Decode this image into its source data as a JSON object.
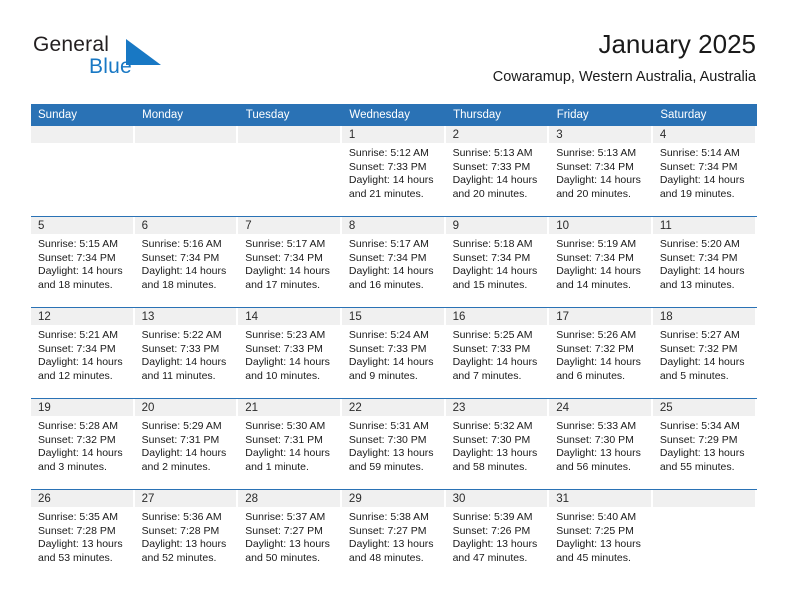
{
  "brand": {
    "name_part1": "General",
    "name_part2": "Blue",
    "logo_icon": "triangle-flag-icon"
  },
  "header": {
    "title": "January 2025",
    "subtitle": "Cowaramup, Western Australia, Australia"
  },
  "colors": {
    "accent_blue": "#2a72b5",
    "brand_blue": "#1878c4",
    "day_band_gray": "#f0f0f0"
  },
  "weekday_headers": [
    "Sunday",
    "Monday",
    "Tuesday",
    "Wednesday",
    "Thursday",
    "Friday",
    "Saturday"
  ],
  "weeks": [
    [
      {
        "day": "",
        "empty": true
      },
      {
        "day": "",
        "empty": true
      },
      {
        "day": "",
        "empty": true
      },
      {
        "day": "1",
        "sunrise": "Sunrise: 5:12 AM",
        "sunset": "Sunset: 7:33 PM",
        "daylight_line1": "Daylight: 14 hours",
        "daylight_line2": "and 21 minutes."
      },
      {
        "day": "2",
        "sunrise": "Sunrise: 5:13 AM",
        "sunset": "Sunset: 7:33 PM",
        "daylight_line1": "Daylight: 14 hours",
        "daylight_line2": "and 20 minutes."
      },
      {
        "day": "3",
        "sunrise": "Sunrise: 5:13 AM",
        "sunset": "Sunset: 7:34 PM",
        "daylight_line1": "Daylight: 14 hours",
        "daylight_line2": "and 20 minutes."
      },
      {
        "day": "4",
        "sunrise": "Sunrise: 5:14 AM",
        "sunset": "Sunset: 7:34 PM",
        "daylight_line1": "Daylight: 14 hours",
        "daylight_line2": "and 19 minutes."
      }
    ],
    [
      {
        "day": "5",
        "sunrise": "Sunrise: 5:15 AM",
        "sunset": "Sunset: 7:34 PM",
        "daylight_line1": "Daylight: 14 hours",
        "daylight_line2": "and 18 minutes."
      },
      {
        "day": "6",
        "sunrise": "Sunrise: 5:16 AM",
        "sunset": "Sunset: 7:34 PM",
        "daylight_line1": "Daylight: 14 hours",
        "daylight_line2": "and 18 minutes."
      },
      {
        "day": "7",
        "sunrise": "Sunrise: 5:17 AM",
        "sunset": "Sunset: 7:34 PM",
        "daylight_line1": "Daylight: 14 hours",
        "daylight_line2": "and 17 minutes."
      },
      {
        "day": "8",
        "sunrise": "Sunrise: 5:17 AM",
        "sunset": "Sunset: 7:34 PM",
        "daylight_line1": "Daylight: 14 hours",
        "daylight_line2": "and 16 minutes."
      },
      {
        "day": "9",
        "sunrise": "Sunrise: 5:18 AM",
        "sunset": "Sunset: 7:34 PM",
        "daylight_line1": "Daylight: 14 hours",
        "daylight_line2": "and 15 minutes."
      },
      {
        "day": "10",
        "sunrise": "Sunrise: 5:19 AM",
        "sunset": "Sunset: 7:34 PM",
        "daylight_line1": "Daylight: 14 hours",
        "daylight_line2": "and 14 minutes."
      },
      {
        "day": "11",
        "sunrise": "Sunrise: 5:20 AM",
        "sunset": "Sunset: 7:34 PM",
        "daylight_line1": "Daylight: 14 hours",
        "daylight_line2": "and 13 minutes."
      }
    ],
    [
      {
        "day": "12",
        "sunrise": "Sunrise: 5:21 AM",
        "sunset": "Sunset: 7:34 PM",
        "daylight_line1": "Daylight: 14 hours",
        "daylight_line2": "and 12 minutes."
      },
      {
        "day": "13",
        "sunrise": "Sunrise: 5:22 AM",
        "sunset": "Sunset: 7:33 PM",
        "daylight_line1": "Daylight: 14 hours",
        "daylight_line2": "and 11 minutes."
      },
      {
        "day": "14",
        "sunrise": "Sunrise: 5:23 AM",
        "sunset": "Sunset: 7:33 PM",
        "daylight_line1": "Daylight: 14 hours",
        "daylight_line2": "and 10 minutes."
      },
      {
        "day": "15",
        "sunrise": "Sunrise: 5:24 AM",
        "sunset": "Sunset: 7:33 PM",
        "daylight_line1": "Daylight: 14 hours",
        "daylight_line2": "and 9 minutes."
      },
      {
        "day": "16",
        "sunrise": "Sunrise: 5:25 AM",
        "sunset": "Sunset: 7:33 PM",
        "daylight_line1": "Daylight: 14 hours",
        "daylight_line2": "and 7 minutes."
      },
      {
        "day": "17",
        "sunrise": "Sunrise: 5:26 AM",
        "sunset": "Sunset: 7:32 PM",
        "daylight_line1": "Daylight: 14 hours",
        "daylight_line2": "and 6 minutes."
      },
      {
        "day": "18",
        "sunrise": "Sunrise: 5:27 AM",
        "sunset": "Sunset: 7:32 PM",
        "daylight_line1": "Daylight: 14 hours",
        "daylight_line2": "and 5 minutes."
      }
    ],
    [
      {
        "day": "19",
        "sunrise": "Sunrise: 5:28 AM",
        "sunset": "Sunset: 7:32 PM",
        "daylight_line1": "Daylight: 14 hours",
        "daylight_line2": "and 3 minutes."
      },
      {
        "day": "20",
        "sunrise": "Sunrise: 5:29 AM",
        "sunset": "Sunset: 7:31 PM",
        "daylight_line1": "Daylight: 14 hours",
        "daylight_line2": "and 2 minutes."
      },
      {
        "day": "21",
        "sunrise": "Sunrise: 5:30 AM",
        "sunset": "Sunset: 7:31 PM",
        "daylight_line1": "Daylight: 14 hours",
        "daylight_line2": "and 1 minute."
      },
      {
        "day": "22",
        "sunrise": "Sunrise: 5:31 AM",
        "sunset": "Sunset: 7:30 PM",
        "daylight_line1": "Daylight: 13 hours",
        "daylight_line2": "and 59 minutes."
      },
      {
        "day": "23",
        "sunrise": "Sunrise: 5:32 AM",
        "sunset": "Sunset: 7:30 PM",
        "daylight_line1": "Daylight: 13 hours",
        "daylight_line2": "and 58 minutes."
      },
      {
        "day": "24",
        "sunrise": "Sunrise: 5:33 AM",
        "sunset": "Sunset: 7:30 PM",
        "daylight_line1": "Daylight: 13 hours",
        "daylight_line2": "and 56 minutes."
      },
      {
        "day": "25",
        "sunrise": "Sunrise: 5:34 AM",
        "sunset": "Sunset: 7:29 PM",
        "daylight_line1": "Daylight: 13 hours",
        "daylight_line2": "and 55 minutes."
      }
    ],
    [
      {
        "day": "26",
        "sunrise": "Sunrise: 5:35 AM",
        "sunset": "Sunset: 7:28 PM",
        "daylight_line1": "Daylight: 13 hours",
        "daylight_line2": "and 53 minutes."
      },
      {
        "day": "27",
        "sunrise": "Sunrise: 5:36 AM",
        "sunset": "Sunset: 7:28 PM",
        "daylight_line1": "Daylight: 13 hours",
        "daylight_line2": "and 52 minutes."
      },
      {
        "day": "28",
        "sunrise": "Sunrise: 5:37 AM",
        "sunset": "Sunset: 7:27 PM",
        "daylight_line1": "Daylight: 13 hours",
        "daylight_line2": "and 50 minutes."
      },
      {
        "day": "29",
        "sunrise": "Sunrise: 5:38 AM",
        "sunset": "Sunset: 7:27 PM",
        "daylight_line1": "Daylight: 13 hours",
        "daylight_line2": "and 48 minutes."
      },
      {
        "day": "30",
        "sunrise": "Sunrise: 5:39 AM",
        "sunset": "Sunset: 7:26 PM",
        "daylight_line1": "Daylight: 13 hours",
        "daylight_line2": "and 47 minutes."
      },
      {
        "day": "31",
        "sunrise": "Sunrise: 5:40 AM",
        "sunset": "Sunset: 7:25 PM",
        "daylight_line1": "Daylight: 13 hours",
        "daylight_line2": "and 45 minutes."
      },
      {
        "day": "",
        "empty": true
      }
    ]
  ]
}
